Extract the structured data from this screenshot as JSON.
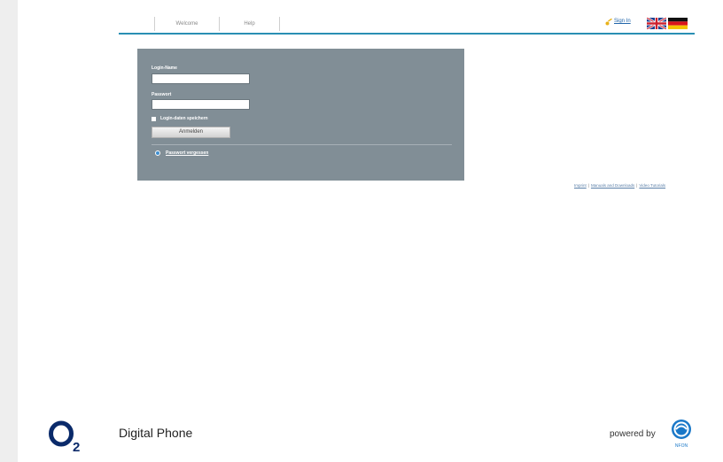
{
  "nav": {
    "tabs": [
      {
        "label": "Welcome"
      },
      {
        "label": "Help"
      }
    ],
    "signin_label": "Sign In"
  },
  "login": {
    "login_name_label": "Login-Name",
    "password_label": "Passwort",
    "login_name_value": "",
    "password_value": "",
    "remember_label": "Login-daten speichern",
    "submit_label": "Anmelden",
    "forgot_label": "Passwort vergessen"
  },
  "footer_links": [
    {
      "label": "Imprint"
    },
    {
      "label": "Manuals and Downloads"
    },
    {
      "label": "Video Tutorials"
    }
  ],
  "brand": {
    "product_name": "Digital Phone",
    "powered_by": "powered by",
    "provider_logo_text": "NFON"
  },
  "colors": {
    "accent": "#2a8fb4",
    "panel": "#818e96",
    "link": "#2266aa"
  },
  "icons": [
    "key-icon",
    "uk-flag-icon",
    "german-flag-icon",
    "info-icon",
    "o2-logo",
    "nfon-logo"
  ]
}
